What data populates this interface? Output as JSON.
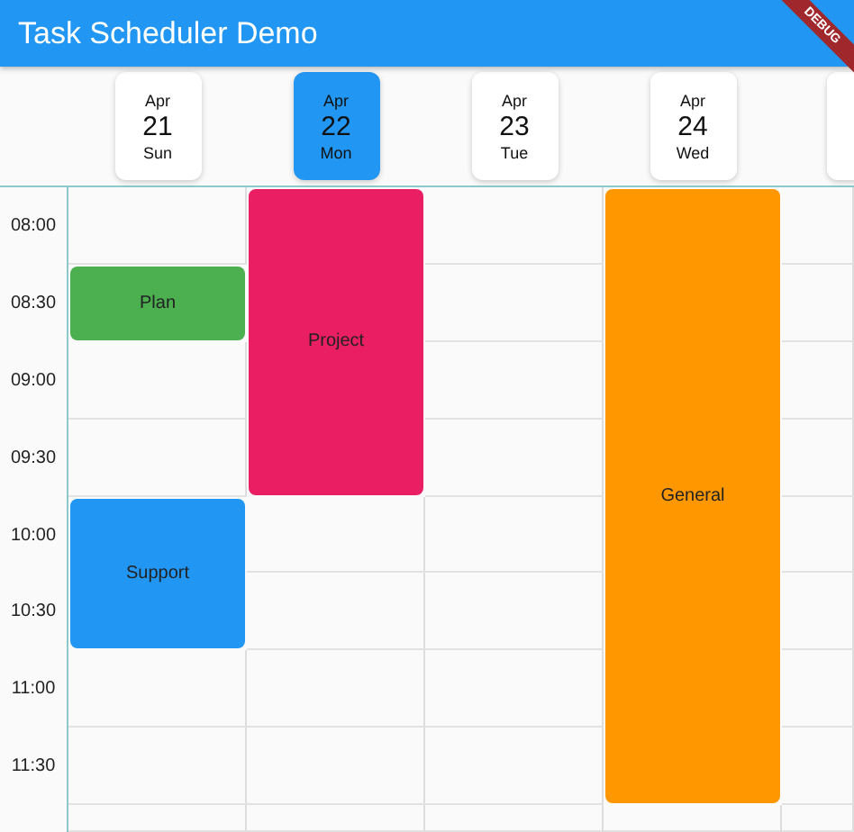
{
  "app_bar": {
    "title": "Task Scheduler Demo"
  },
  "debug_banner": {
    "label": "DEBUG"
  },
  "times": [
    "08:00",
    "08:30",
    "09:00",
    "09:30",
    "10:00",
    "10:30",
    "11:00",
    "11:30"
  ],
  "days": [
    {
      "month": "Apr",
      "date": "21",
      "weekday": "Sun",
      "selected": false,
      "slots": [
        {
          "kind": "free"
        },
        {
          "kind": "event",
          "title": "Plan",
          "color": "#4caf50"
        },
        {
          "kind": "free"
        },
        {
          "kind": "free"
        },
        {
          "kind": "event",
          "title": "Support",
          "color": "#2196f3"
        },
        {
          "kind": "continues"
        },
        {
          "kind": "free"
        },
        {
          "kind": "free"
        }
      ]
    },
    {
      "month": "Apr",
      "date": "22",
      "weekday": "Mon",
      "selected": true,
      "slots": [
        {
          "kind": "event",
          "title": "Project",
          "color": "#e91e63"
        },
        {
          "kind": "continues"
        },
        {
          "kind": "continues"
        },
        {
          "kind": "continues"
        },
        {
          "kind": "free"
        },
        {
          "kind": "free"
        },
        {
          "kind": "free"
        },
        {
          "kind": "free"
        }
      ]
    },
    {
      "month": "Apr",
      "date": "23",
      "weekday": "Tue",
      "selected": false,
      "slots": [
        {
          "kind": "free"
        },
        {
          "kind": "free"
        },
        {
          "kind": "free"
        },
        {
          "kind": "free"
        },
        {
          "kind": "free"
        },
        {
          "kind": "free"
        },
        {
          "kind": "free"
        },
        {
          "kind": "free"
        }
      ]
    },
    {
      "month": "Apr",
      "date": "24",
      "weekday": "Wed",
      "selected": false,
      "slots": [
        {
          "kind": "event",
          "title": "General",
          "color": "#ff9800"
        },
        {
          "kind": "continues"
        },
        {
          "kind": "continues"
        },
        {
          "kind": "continues"
        },
        {
          "kind": "continues"
        },
        {
          "kind": "continues"
        },
        {
          "kind": "continues"
        },
        {
          "kind": "continues"
        }
      ]
    }
  ]
}
